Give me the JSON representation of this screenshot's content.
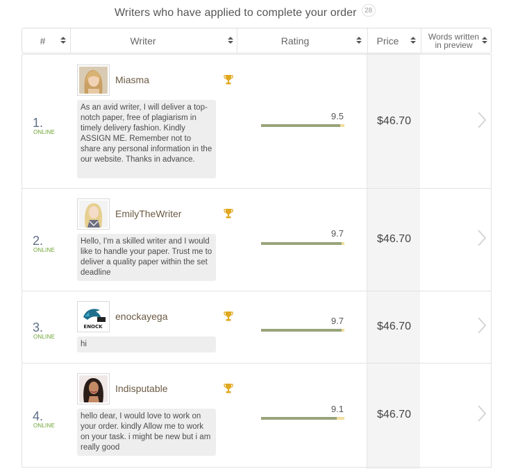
{
  "heading": {
    "title": "Writers who have applied to complete your order",
    "count": "28"
  },
  "columns": {
    "num": "#",
    "writer": "Writer",
    "rating": "Rating",
    "price": "Price",
    "words": "Words written in preview"
  },
  "status_label": "ONLINE",
  "accent_colors": {
    "online": "#6aa12d",
    "rating_bar": "#98a47a",
    "rating_bar_bg": "#f2dda0",
    "trophy": "#e0a820"
  },
  "writers": [
    {
      "num": "1.",
      "name": "Miasma",
      "avatar_icon": "portrait-blonde-woman",
      "message": "As an avid writer, I will deliver a top-notch paper, free of plagiarism in timely delivery fashion. Kindly ASSIGN ME. Remember not to share any personal information in the our website. Thanks in advance.",
      "rating": "9.5",
      "rating_fraction": 0.95,
      "price": "$46.70"
    },
    {
      "num": "2.",
      "name": "EmilyTheWriter",
      "avatar_icon": "portrait-blonde-woman",
      "message": "Hello, I'm a skilled writer and I would like to handle your paper. Trust me to deliver a quality paper within the set deadline",
      "rating": "9.7",
      "rating_fraction": 0.97,
      "price": "$46.70"
    },
    {
      "num": "3.",
      "name": "enockayega",
      "avatar_icon": "shark-logo",
      "avatar_text": "ENOCK",
      "message": "hi",
      "rating": "9.7",
      "rating_fraction": 0.97,
      "price": "$46.70"
    },
    {
      "num": "4.",
      "name": "Indisputable",
      "avatar_icon": "portrait-dark-hair-woman",
      "message": "hello dear, I would love to work on your order. kindly Allow me to work on your task. i might be new but i am really good",
      "rating": "9.1",
      "rating_fraction": 0.91,
      "price": "$46.70"
    }
  ]
}
